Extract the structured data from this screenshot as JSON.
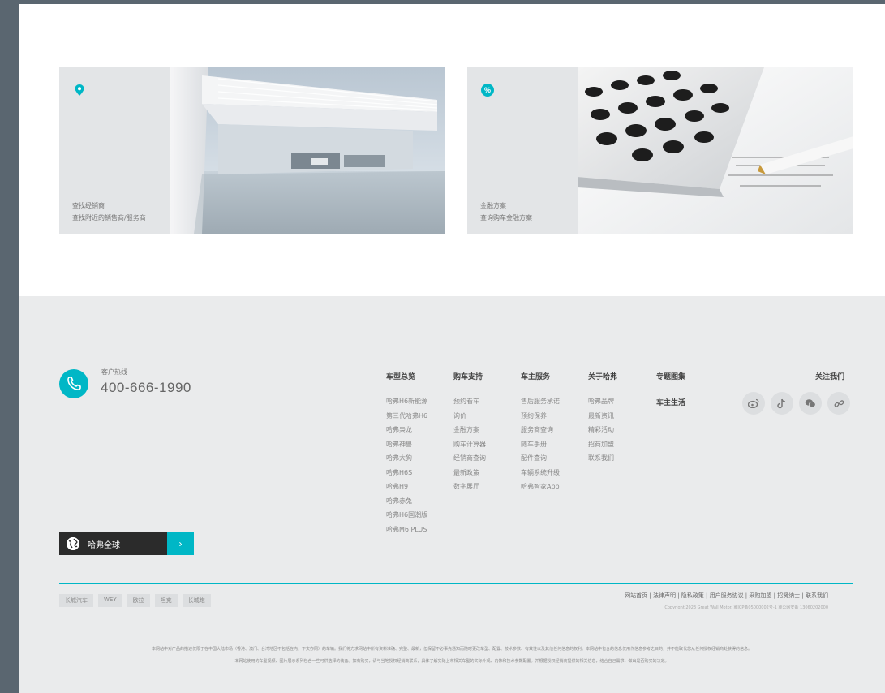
{
  "cards": [
    {
      "title": "查找经销商",
      "subtitle": "查找附近的销售商/服务商",
      "icon": "location-pin-icon"
    },
    {
      "title": "金融方案",
      "subtitle": "查询购车金融方案",
      "icon": "percent-icon",
      "icon_text": "%"
    }
  ],
  "hotline": {
    "label": "客户热线",
    "number": "400-666-1990"
  },
  "columns": [
    {
      "head": "车型总览",
      "items": [
        "哈弗H6新能源",
        "第三代哈弗H6",
        "哈弗枭龙",
        "哈弗神兽",
        "哈弗大狗",
        "哈弗H6S",
        "哈弗H9",
        "哈弗赤兔",
        "哈弗H6国潮版",
        "哈弗M6 PLUS"
      ]
    },
    {
      "head": "购车支持",
      "items": [
        "预约看车",
        "询价",
        "金融方案",
        "购车计算器",
        "经销商查询",
        "最新政策",
        "数字展厅"
      ]
    },
    {
      "head": "车主服务",
      "items": [
        "售后服务承诺",
        "预约保养",
        "服务商查询",
        "随车手册",
        "配件查询",
        "车辆系统升级",
        "哈弗智家App"
      ]
    },
    {
      "head": "关于哈弗",
      "items": [
        "哈弗品牌",
        "最新资讯",
        "精彩活动",
        "招商加盟",
        "联系我们"
      ]
    },
    {
      "head": "专题图集",
      "items": [],
      "big": "车主生活"
    }
  ],
  "follow": {
    "label": "关注我们",
    "icons": [
      "weibo-icon",
      "tiktok-icon",
      "wechat-icon",
      "link-icon"
    ]
  },
  "global": {
    "label": "哈弗全球",
    "arrow": "›"
  },
  "tags": [
    "长城汽车",
    "WEY",
    "欧拉",
    "坦克",
    "长城炮"
  ],
  "bottom_links": "网站首页 | 法律声明 | 隐私政策 | 用户服务协议 | 采购加盟 | 招贤纳士 | 联系我们",
  "copyright": "Copyright 2023 Great Wall Motor. 冀ICP备05000002号-1 冀公网安备 13060202000",
  "disclaimer": [
    "本网站中对产品的描述仅限于在中国大陆市场（香港、澳门、台湾地区不包括在内，下文亦同）的车辆。我们将力求网站中所有资料准确、完整、最新，但保留不必事先通知而随时更改车型、配置、技术参数、有效性以及其他任何信息的权利。本网站中包含的信息仅用作信息参考之目的，并不能取代您从任何授权经销商处获得的信息。",
    "本网站使用的车型视频、图片展示系列包含一些可供选择的装备。如有购买，请与当地授权经销商联系，具体了解实际上市相关车型的实际外观、内饰和技术参数配置。并根据授权经销商提供的相关信息，结合自己需求，做出是否购买的决定。"
  ]
}
